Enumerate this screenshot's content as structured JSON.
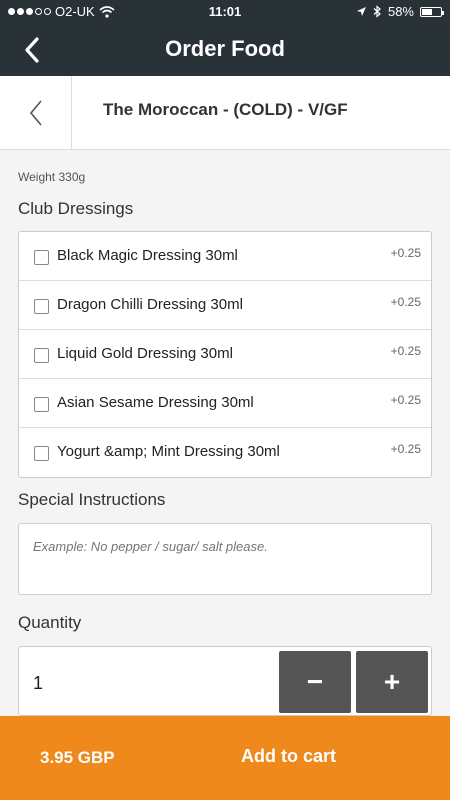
{
  "status_bar": {
    "carrier": "O2-UK",
    "time": "11:01",
    "battery": "58%",
    "battery_level": 0.58,
    "signal_bars_filled": 3,
    "signal_bars_total": 5
  },
  "nav": {
    "title": "Order Food",
    "back_icon": "chevron-left-icon"
  },
  "item": {
    "title": "The Moroccan - (COLD) - V/GF",
    "weight": "Weight 330g"
  },
  "dressings": {
    "label": "Club Dressings",
    "items": [
      {
        "name": "Black Magic Dressing 30ml",
        "price": "+0.25"
      },
      {
        "name": "Dragon Chilli Dressing 30ml",
        "price": "+0.25"
      },
      {
        "name": "Liquid Gold Dressing 30ml",
        "price": "+0.25"
      },
      {
        "name": "Asian Sesame Dressing 30ml",
        "price": "+0.25"
      },
      {
        "name": "Yogurt &amp; Mint Dressing 30ml",
        "price": "+0.25"
      }
    ]
  },
  "instructions": {
    "label": "Special Instructions",
    "placeholder": "Example: No pepper / sugar/ salt please."
  },
  "quantity": {
    "label": "Quantity",
    "value": "1",
    "minus": "−",
    "plus": "+"
  },
  "cart": {
    "price": "3.95 GBP",
    "action": "Add to cart"
  },
  "colors": {
    "header_bg": "#283237",
    "accent": "#f0891c"
  }
}
